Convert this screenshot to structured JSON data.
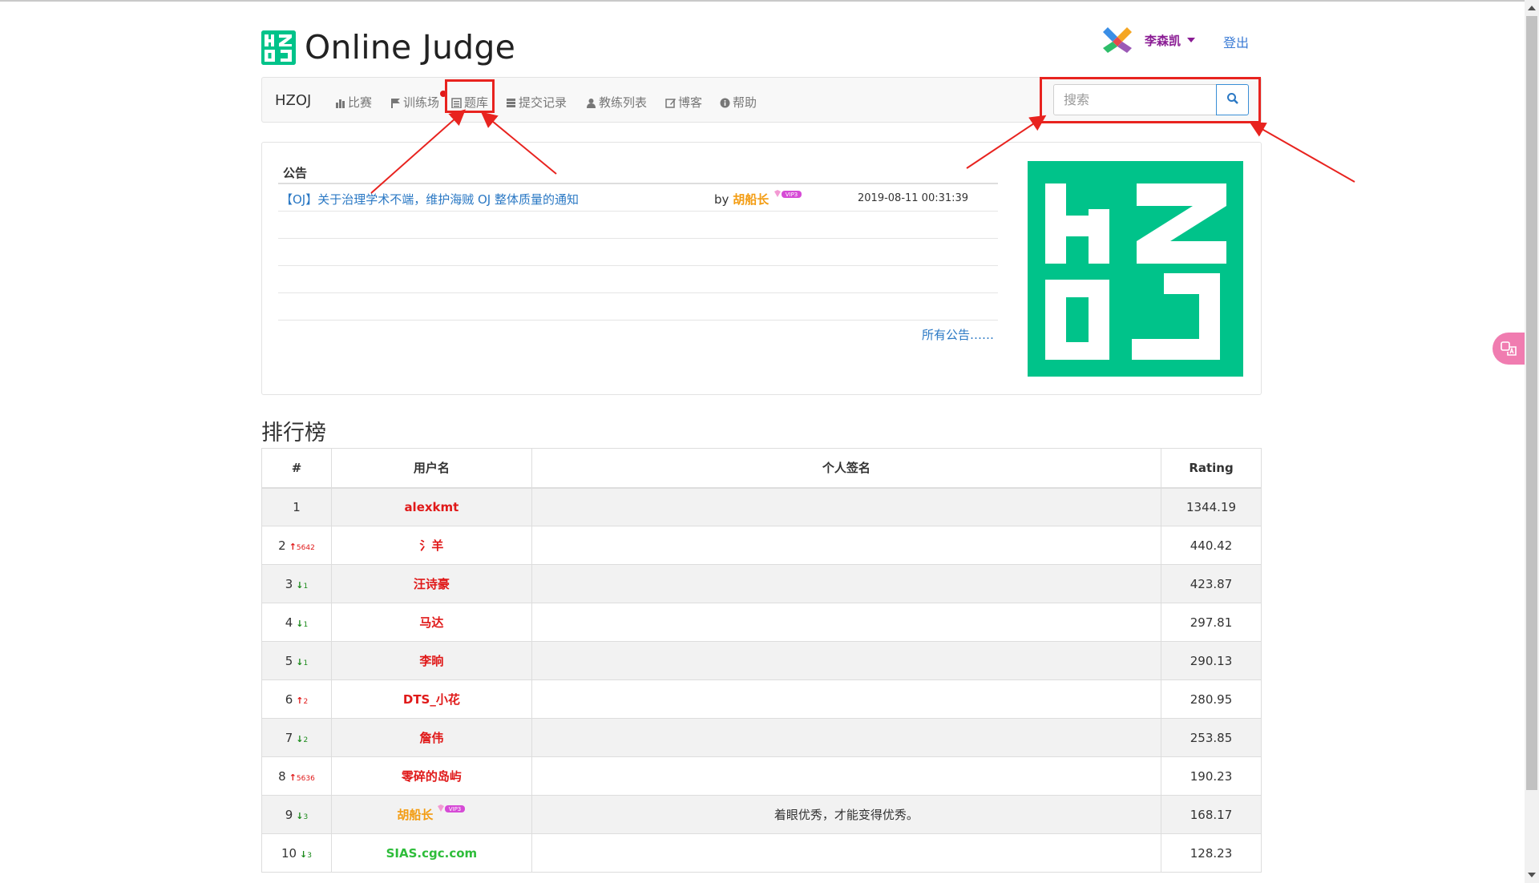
{
  "header": {
    "logo_text": "HZOJ",
    "site_title": "Online Judge",
    "username": "李森凯",
    "logout": "登出"
  },
  "nav": {
    "brand": "HZOJ",
    "items": [
      {
        "label": "比赛",
        "icon": "bar-chart-icon"
      },
      {
        "label": "训练场",
        "icon": "flag-icon"
      },
      {
        "label": "题库",
        "icon": "list-icon"
      },
      {
        "label": "提交记录",
        "icon": "tasks-icon"
      },
      {
        "label": "教练列表",
        "icon": "user-icon"
      },
      {
        "label": "博客",
        "icon": "edit-icon"
      },
      {
        "label": "帮助",
        "icon": "info-icon"
      }
    ],
    "search_placeholder": "搜索"
  },
  "notice": {
    "header": "公告",
    "items": [
      {
        "title": "【OJ】关于治理学术不端，维护海贼 OJ 整体质量的通知",
        "by": "by",
        "author": "胡船长",
        "badge": "VIP3",
        "time": "2019-08-11 00:31:39"
      }
    ],
    "all_link": "所有公告……"
  },
  "ranking": {
    "title": "排行榜",
    "columns": [
      "#",
      "用户名",
      "个人签名",
      "Rating"
    ],
    "rows": [
      {
        "rank": "1",
        "change": "",
        "dir": "",
        "user": "alexkmt",
        "color": "#e01919",
        "badge": "",
        "sign": "",
        "rating": "1344.19"
      },
      {
        "rank": "2",
        "change": "5642",
        "dir": "up",
        "user": "氵羊",
        "color": "#e01919",
        "badge": "",
        "sign": "",
        "rating": "440.42"
      },
      {
        "rank": "3",
        "change": "1",
        "dir": "down",
        "user": "汪诗豪",
        "color": "#e01919",
        "badge": "",
        "sign": "",
        "rating": "423.87"
      },
      {
        "rank": "4",
        "change": "1",
        "dir": "down",
        "user": "马达",
        "color": "#e01919",
        "badge": "",
        "sign": "",
        "rating": "297.81"
      },
      {
        "rank": "5",
        "change": "1",
        "dir": "down",
        "user": "李晌",
        "color": "#e01919",
        "badge": "",
        "sign": "",
        "rating": "290.13"
      },
      {
        "rank": "6",
        "change": "2",
        "dir": "up",
        "user": "DTS_小花",
        "color": "#e01919",
        "badge": "",
        "sign": "",
        "rating": "280.95"
      },
      {
        "rank": "7",
        "change": "2",
        "dir": "down",
        "user": "詹伟",
        "color": "#e01919",
        "badge": "",
        "sign": "",
        "rating": "253.85"
      },
      {
        "rank": "8",
        "change": "5636",
        "dir": "up",
        "user": "零碎的岛屿",
        "color": "#e01919",
        "badge": "",
        "sign": "",
        "rating": "190.23"
      },
      {
        "rank": "9",
        "change": "3",
        "dir": "down",
        "user": "胡船长",
        "color": "#f39c12",
        "badge": "VIP3",
        "sign": "着眼优秀，才能变得优秀。",
        "rating": "168.17"
      },
      {
        "rank": "10",
        "change": "3",
        "dir": "down",
        "user": "SIAS.cgc.com",
        "color": "#2ebd3a",
        "badge": "",
        "sign": "",
        "rating": "128.23"
      }
    ]
  },
  "colors": {
    "brand_green": "#00c38a",
    "link_blue": "#2a78c4",
    "annotation_red": "#e8231f"
  }
}
